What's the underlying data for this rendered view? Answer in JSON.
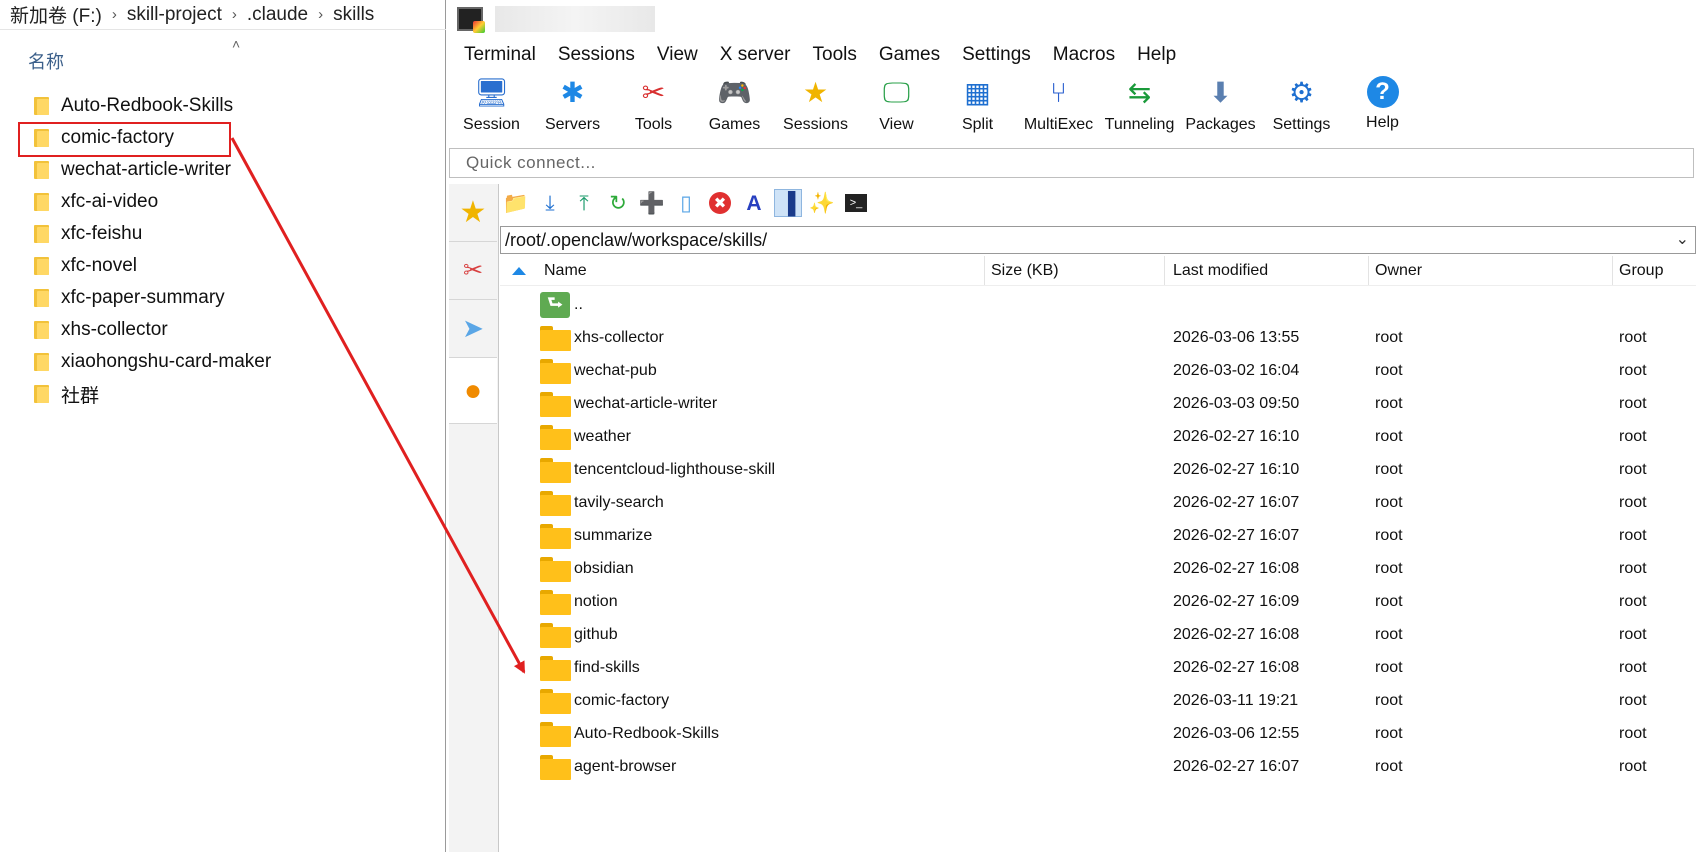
{
  "explorer": {
    "breadcrumb": [
      "新加卷 (F:)",
      "skill-project",
      ".claude",
      "skills"
    ],
    "column_header": "名称",
    "items": [
      {
        "label": "Auto-Redbook-Skills"
      },
      {
        "label": "comic-factory"
      },
      {
        "label": "wechat-article-writer"
      },
      {
        "label": "xfc-ai-video"
      },
      {
        "label": "xfc-feishu"
      },
      {
        "label": "xfc-novel"
      },
      {
        "label": "xfc-paper-summary"
      },
      {
        "label": "xhs-collector"
      },
      {
        "label": "xiaohongshu-card-maker"
      },
      {
        "label": "社群"
      }
    ],
    "highlighted_item": "comic-factory"
  },
  "moba": {
    "menu": [
      "Terminal",
      "Sessions",
      "View",
      "X server",
      "Tools",
      "Games",
      "Settings",
      "Macros",
      "Help"
    ],
    "toolbar": [
      {
        "label": "Session",
        "icon": "session-icon"
      },
      {
        "label": "Servers",
        "icon": "servers-icon"
      },
      {
        "label": "Tools",
        "icon": "tools-icon"
      },
      {
        "label": "Games",
        "icon": "games-icon"
      },
      {
        "label": "Sessions",
        "icon": "star-icon"
      },
      {
        "label": "View",
        "icon": "view-icon"
      },
      {
        "label": "Split",
        "icon": "split-icon"
      },
      {
        "label": "MultiExec",
        "icon": "multiexec-icon"
      },
      {
        "label": "Tunneling",
        "icon": "tunneling-icon"
      },
      {
        "label": "Packages",
        "icon": "packages-icon"
      },
      {
        "label": "Settings",
        "icon": "settings-icon"
      },
      {
        "label": "Help",
        "icon": "help-icon"
      }
    ],
    "quick_connect_placeholder": "Quick connect...",
    "sftp": {
      "path": "/root/.openclaw/workspace/skills/",
      "columns": {
        "name": "Name",
        "size": "Size (KB)",
        "modified": "Last modified",
        "owner": "Owner",
        "group": "Group"
      },
      "parent_label": "..",
      "rows": [
        {
          "name": "xhs-collector",
          "size": "",
          "modified": "2026-03-06 13:55",
          "owner": "root",
          "group": "root"
        },
        {
          "name": "wechat-pub",
          "size": "",
          "modified": "2026-03-02 16:04",
          "owner": "root",
          "group": "root"
        },
        {
          "name": "wechat-article-writer",
          "size": "",
          "modified": "2026-03-03 09:50",
          "owner": "root",
          "group": "root"
        },
        {
          "name": "weather",
          "size": "",
          "modified": "2026-02-27 16:10",
          "owner": "root",
          "group": "root"
        },
        {
          "name": "tencentcloud-lighthouse-skill",
          "size": "",
          "modified": "2026-02-27 16:10",
          "owner": "root",
          "group": "root"
        },
        {
          "name": "tavily-search",
          "size": "",
          "modified": "2026-02-27 16:07",
          "owner": "root",
          "group": "root"
        },
        {
          "name": "summarize",
          "size": "",
          "modified": "2026-02-27 16:07",
          "owner": "root",
          "group": "root"
        },
        {
          "name": "obsidian",
          "size": "",
          "modified": "2026-02-27 16:08",
          "owner": "root",
          "group": "root"
        },
        {
          "name": "notion",
          "size": "",
          "modified": "2026-02-27 16:09",
          "owner": "root",
          "group": "root"
        },
        {
          "name": "github",
          "size": "",
          "modified": "2026-02-27 16:08",
          "owner": "root",
          "group": "root"
        },
        {
          "name": "find-skills",
          "size": "",
          "modified": "2026-02-27 16:08",
          "owner": "root",
          "group": "root"
        },
        {
          "name": "comic-factory",
          "size": "",
          "modified": "2026-03-11 19:21",
          "owner": "root",
          "group": "root"
        },
        {
          "name": "Auto-Redbook-Skills",
          "size": "",
          "modified": "2026-03-06 12:55",
          "owner": "root",
          "group": "root"
        },
        {
          "name": "agent-browser",
          "size": "",
          "modified": "2026-02-27 16:07",
          "owner": "root",
          "group": "root"
        }
      ],
      "highlighted_row": "comic-factory"
    }
  },
  "colors": {
    "highlight": "#e02020",
    "folder": "#ffc01a",
    "accent": "#1e88e5"
  }
}
